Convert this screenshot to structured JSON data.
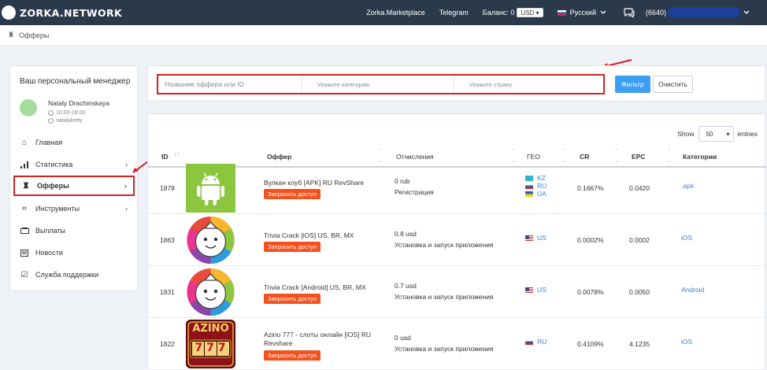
{
  "nav": {
    "logo": "ZORKA.NETWORK",
    "marketplace": "Zorka.Marketplace",
    "telegram": "Telegram",
    "balance_label": "Баланс: 0",
    "currency": "USD",
    "language": "Русский",
    "user_id": "(6640)"
  },
  "breadcrumb": {
    "label": "Офферы"
  },
  "manager": {
    "title": "Ваш персональный менеджер",
    "name": "Nataly Drachinskaya",
    "hours": "10:00-19:00",
    "skype": "natalybetty"
  },
  "menu": [
    {
      "label": "Главная",
      "icon": "home-icon",
      "has_arrow": false,
      "active": false
    },
    {
      "label": "Статистика",
      "icon": "chart-icon",
      "has_arrow": true,
      "active": false
    },
    {
      "label": "Офферы",
      "icon": "chess-king-icon",
      "has_arrow": true,
      "active": true
    },
    {
      "label": "Инструменты",
      "icon": "puzzle-icon",
      "has_arrow": true,
      "active": false
    },
    {
      "label": "Выплаты",
      "icon": "money-icon",
      "has_arrow": false,
      "active": false
    },
    {
      "label": "Новости",
      "icon": "newspaper-icon",
      "has_arrow": false,
      "active": false
    },
    {
      "label": "Служба поддержки",
      "icon": "checkbox-icon",
      "has_arrow": false,
      "active": false
    }
  ],
  "filter": {
    "name_placeholder": "Название оффера или ID",
    "category_placeholder": "Укажите категорию",
    "country_placeholder": "Укажите страну",
    "filter_button": "Фильтр",
    "clear_button": "Очистить"
  },
  "table": {
    "show_label": "Show",
    "show_value": "50",
    "entries_label": "entries",
    "columns": {
      "id": "ID",
      "offer": "Оффер",
      "payout": "Отчисления",
      "geo": "ГЕО",
      "cr": "CR",
      "epc": "EPC",
      "category": "Категории"
    },
    "request_button": "Запросить доступ",
    "rows": [
      {
        "id": "1878",
        "thumb": "android-icon",
        "name": "Вулкан клуб [APK] RU RevShare",
        "payout_amount": "0 rub",
        "payout_type": "Регистрация",
        "geo": [
          {
            "code": "KZ",
            "flag": "kz"
          },
          {
            "code": "RU",
            "flag": "ru"
          },
          {
            "code": "UA",
            "flag": "ua"
          }
        ],
        "cr": "0.1667%",
        "epc": "0.0420",
        "category": ".apk"
      },
      {
        "id": "1863",
        "thumb": "trivia-crack-icon",
        "name": "Trivia Crack [iOS] US, BR, MX",
        "payout_amount": "0.8 usd",
        "payout_type": "Установка и запуск приложения",
        "geo": [
          {
            "code": "US",
            "flag": "us"
          }
        ],
        "cr": "0.0002%",
        "epc": "0.0002",
        "category": "iOS"
      },
      {
        "id": "1831",
        "thumb": "trivia-crack-icon",
        "name": "Trivia Crack [Android] US, BR, MX",
        "payout_amount": "0.7 usd",
        "payout_type": "Установка и запуск приложения",
        "geo": [
          {
            "code": "US",
            "flag": "us"
          }
        ],
        "cr": "0.0078%",
        "epc": "0.0050",
        "category": "Android"
      },
      {
        "id": "1822",
        "thumb": "azino-777-icon",
        "name": "Azino 777 - слоты онлайн [iOS] RU Revshare",
        "payout_amount": "0 usd",
        "payout_type": "Установка и запуск приложения",
        "geo": [
          {
            "code": "RU",
            "flag": "ru"
          }
        ],
        "cr": "0.4109%",
        "epc": "4.1235",
        "category": "iOS"
      }
    ]
  }
}
